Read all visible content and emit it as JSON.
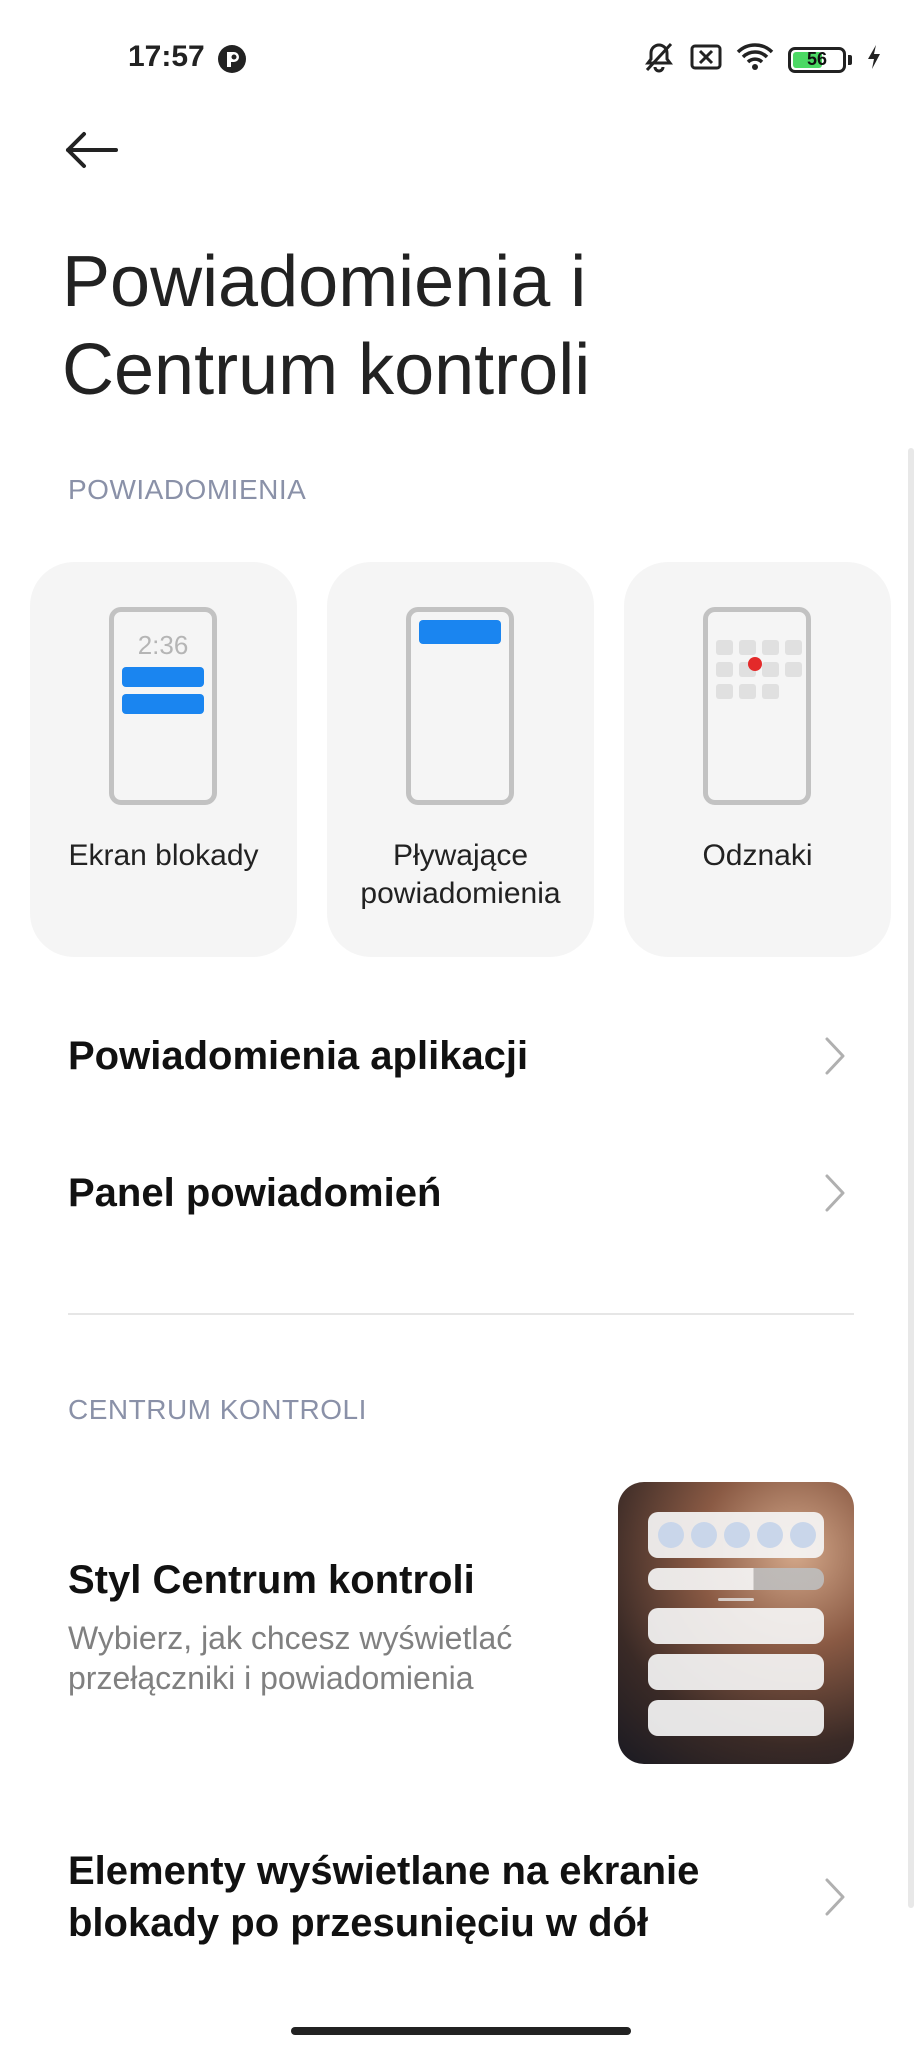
{
  "status_bar": {
    "time": "17:57",
    "battery_level": "56",
    "icons": [
      "notification-muted-icon",
      "sim-off-icon",
      "wifi-icon",
      "battery-icon",
      "charging-icon"
    ]
  },
  "header": {
    "title_line1": "Powiadomienia i",
    "title_line2": "Centrum kontroli"
  },
  "notifications_section": {
    "header": "POWIADOMIENIA",
    "cards": [
      {
        "label": "Ekran blokady",
        "preview_time": "2:36"
      },
      {
        "label_line1": "Pływające",
        "label_line2": "powiadomienia"
      },
      {
        "label": "Odznaki"
      }
    ],
    "items": [
      {
        "label": "Powiadomienia aplikacji"
      },
      {
        "label": "Panel powiadomień"
      }
    ]
  },
  "control_center_section": {
    "header": "CENTRUM KONTROLI",
    "style_item": {
      "title": "Styl Centrum kontroli",
      "subtitle_line1": "Wybierz, jak chcesz wyświetlać",
      "subtitle_line2": "przełączniki i powiadomienia"
    },
    "lockscreen_item": {
      "label_line1": "Elementy wyświetlane na ekranie",
      "label_line2": "blokady po przesunięciu w dół"
    }
  },
  "colors": {
    "accent_blue": "#1a85f0",
    "badge_red": "#e32a2a",
    "section_header": "#8a91a8",
    "card_bg": "#f5f5f5"
  }
}
